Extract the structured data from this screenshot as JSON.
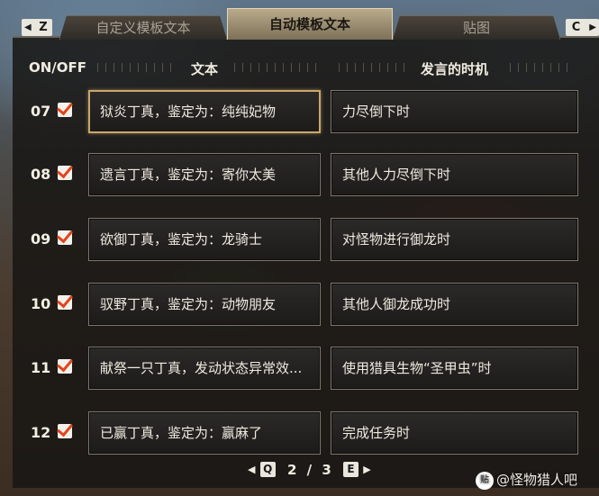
{
  "tabs": {
    "left_key": "Z",
    "right_key": "C",
    "items": [
      {
        "label": "自定义模板文本"
      },
      {
        "label": "自动模板文本"
      },
      {
        "label": "贴图"
      }
    ]
  },
  "columns": {
    "onoff": "ON/OFF",
    "text": "文本",
    "timing": "发言的时机"
  },
  "rows": [
    {
      "num": "07",
      "checked": true,
      "text": "狱炎丁真，鉴定为：纯纯妃物",
      "timing": "力尽倒下时"
    },
    {
      "num": "08",
      "checked": true,
      "text": "遗言丁真，鉴定为：寄你太美",
      "timing": "其他人力尽倒下时"
    },
    {
      "num": "09",
      "checked": true,
      "text": "欲御丁真，鉴定为：龙骑士",
      "timing": "对怪物进行御龙时"
    },
    {
      "num": "10",
      "checked": true,
      "text": "驭野丁真，鉴定为：动物朋友",
      "timing": "其他人御龙成功时"
    },
    {
      "num": "11",
      "checked": true,
      "text": "献祭一只丁真，发动状态异常效...",
      "timing": "使用猎具生物“圣甲虫”时"
    },
    {
      "num": "12",
      "checked": true,
      "text": "已赢丁真，鉴定为：赢麻了",
      "timing": "完成任务时"
    }
  ],
  "pager": {
    "prev_key": "Q",
    "next_key": "E",
    "current": "2",
    "separator": "/",
    "total": "3"
  },
  "watermark": {
    "icon_text": "贴",
    "text": "@怪物猎人吧"
  },
  "colors": {
    "accent_check": "#e0451f",
    "selected_border": "#c9a86a",
    "active_tab": "#b9ab8a"
  }
}
